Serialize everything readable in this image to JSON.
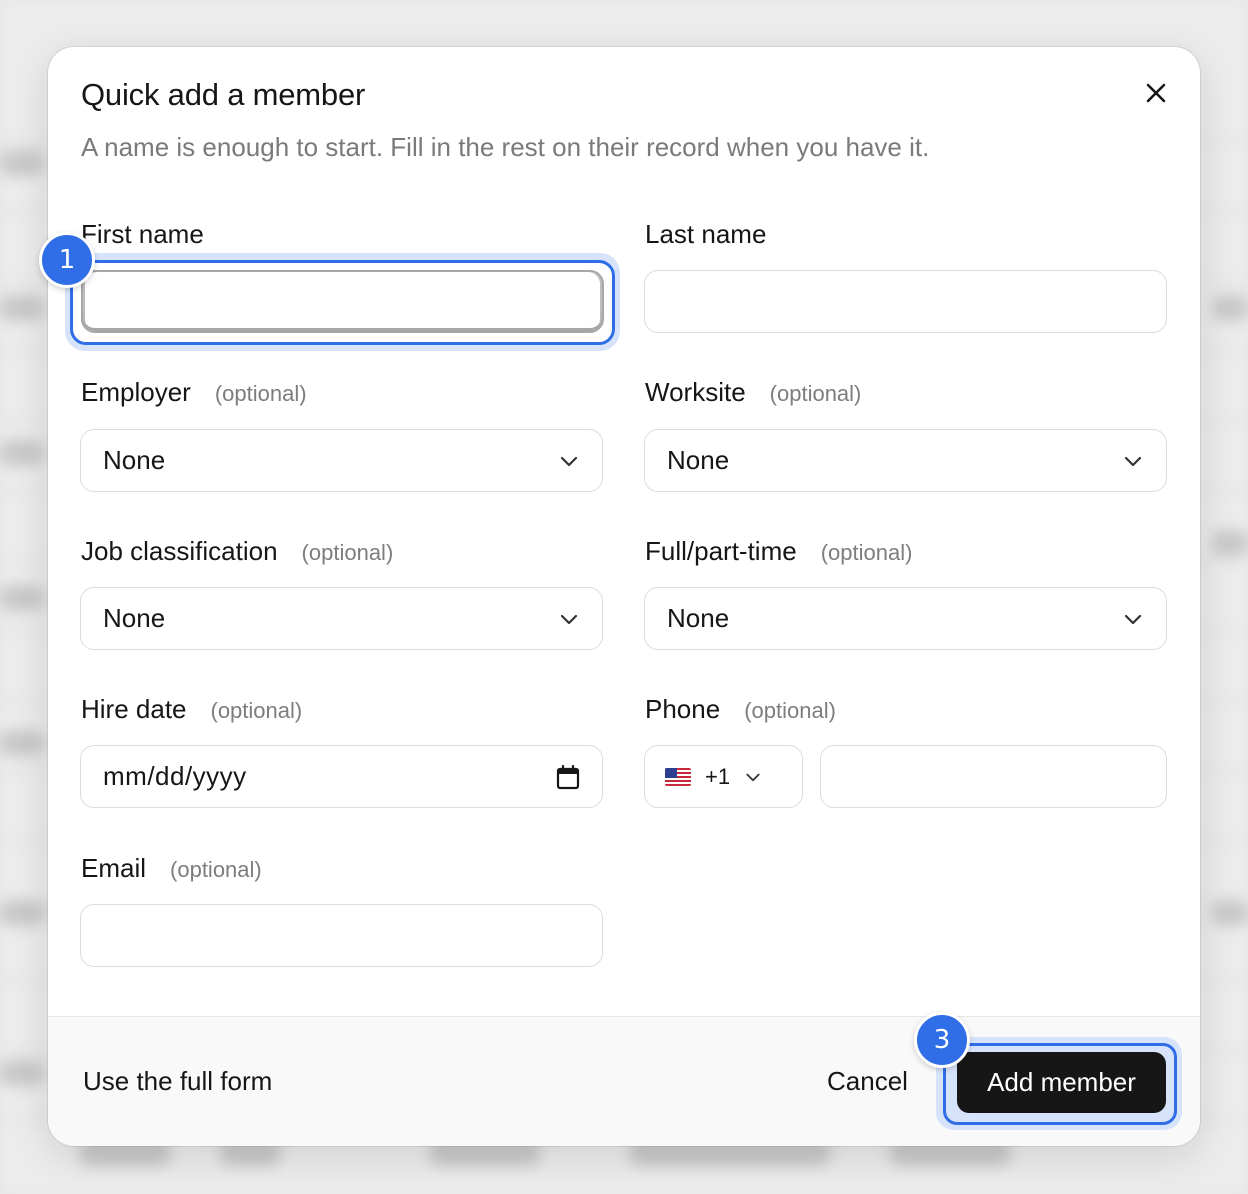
{
  "modal": {
    "title": "Quick add a member",
    "subtitle": "A name is enough to start. Fill in the rest on their record when you have it."
  },
  "fields": {
    "first_name": {
      "label": "First name",
      "value": ""
    },
    "last_name": {
      "label": "Last name",
      "value": ""
    },
    "employer": {
      "label": "Employer",
      "optional": "(optional)",
      "value": "None"
    },
    "worksite": {
      "label": "Worksite",
      "optional": "(optional)",
      "value": "None"
    },
    "job_classification": {
      "label": "Job classification",
      "optional": "(optional)",
      "value": "None"
    },
    "full_part_time": {
      "label": "Full/part-time",
      "optional": "(optional)",
      "value": "None"
    },
    "hire_date": {
      "label": "Hire date",
      "optional": "(optional)",
      "placeholder": "mm/dd/yyyy"
    },
    "phone": {
      "label": "Phone",
      "optional": "(optional)",
      "country_code": "+1",
      "country_flag": "us-flag-icon",
      "value": ""
    },
    "email": {
      "label": "Email",
      "optional": "(optional)",
      "value": ""
    }
  },
  "footer": {
    "full_form_link": "Use the full form",
    "cancel_label": "Cancel",
    "submit_label": "Add member"
  },
  "annotations": {
    "badge_1": "1",
    "badge_3": "3"
  },
  "colors": {
    "accent": "#2f6ee6",
    "focus_ring": "#d6e3fb",
    "primary_button": "#161616",
    "muted_text": "#7a7a7a"
  }
}
